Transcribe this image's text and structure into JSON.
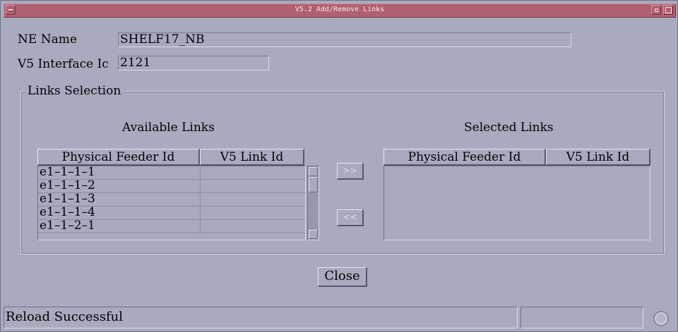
{
  "window": {
    "title": "V5.2 Add/Remove Links"
  },
  "form": {
    "ne_name_label": "NE Name",
    "ne_name_value": "SHELF17_NB",
    "interface_label": "V5 Interface Ic",
    "interface_value": "2121"
  },
  "links_selection": {
    "group_title": "Links Selection",
    "available": {
      "heading": "Available Links",
      "columns": [
        "Physical Feeder Id",
        "V5 Link Id"
      ],
      "rows": [
        {
          "feeder": "e1–1–1–1",
          "link": ""
        },
        {
          "feeder": "e1–1–1–2",
          "link": ""
        },
        {
          "feeder": "e1–1–1–3",
          "link": ""
        },
        {
          "feeder": "e1–1–1–4",
          "link": ""
        },
        {
          "feeder": "e1–1–2–1",
          "link": ""
        }
      ]
    },
    "selected": {
      "heading": "Selected Links",
      "columns": [
        "Physical Feeder Id",
        "V5 Link Id"
      ],
      "rows": []
    },
    "add_label": ">>",
    "remove_label": "<<"
  },
  "actions": {
    "close_label": "Close"
  },
  "status": {
    "message": "Reload Successful"
  }
}
